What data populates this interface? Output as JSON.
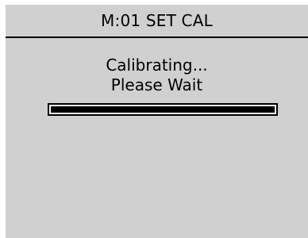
{
  "header": {
    "title": "M:01 SET CAL"
  },
  "message": {
    "line1": "Calibrating...",
    "line2": "Please Wait"
  },
  "progress": {
    "fraction": 1.0
  },
  "colors": {
    "screen_bg": "#d0d0d0",
    "text": "#000000",
    "bar_track": "#ffffff",
    "bar_fill": "#000000"
  }
}
